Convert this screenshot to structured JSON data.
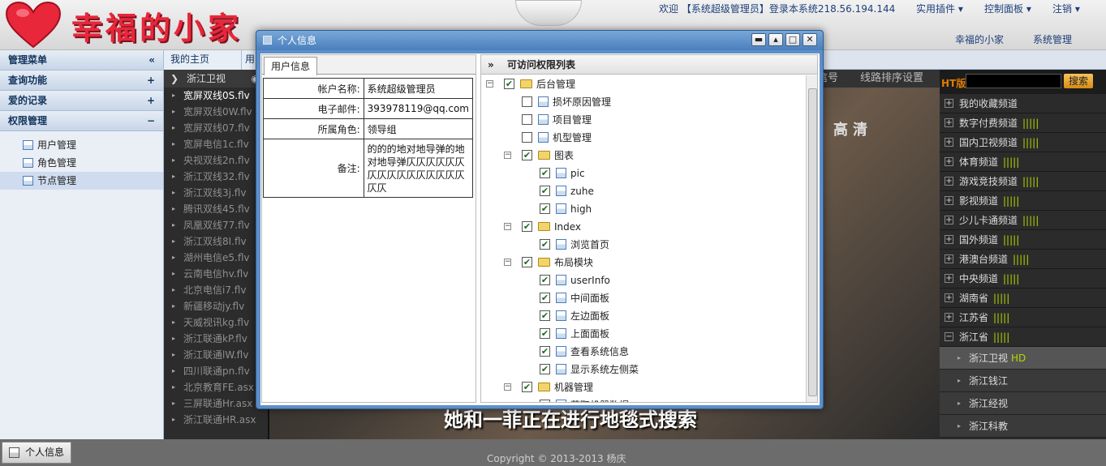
{
  "header": {
    "logo_text": "幸福的小家",
    "welcome": "欢迎 【系统超级管理员】登录本系统218.56.194.144",
    "menu": [
      "实用插件 ▾",
      "控制面板 ▾",
      "注销 ▾"
    ],
    "links": [
      "幸福的小家",
      "系统管理"
    ]
  },
  "sidebar": {
    "title": "管理菜单",
    "title_sym": "«",
    "groups": [
      {
        "label": "查询功能",
        "sym": "+"
      },
      {
        "label": "爱的记录",
        "sym": "+"
      },
      {
        "label": "权限管理",
        "sym": "−"
      }
    ],
    "items": [
      "用户管理",
      "角色管理",
      "节点管理"
    ]
  },
  "tabs": [
    "我的主页",
    "用"
  ],
  "channels": {
    "header": "浙江卫视",
    "arrow": "❯",
    "eye": "◉",
    "items": [
      "宽屏双线0S.flv",
      "宽屏双线0W.flv",
      "宽屏双线07.flv",
      "宽屏电信1c.flv",
      "央视双线2n.flv",
      "浙江双线32.flv",
      "浙江双线3j.flv",
      "腾讯双线45.flv",
      "凤凰双线77.flv",
      "浙江双线8I.flv",
      "湖州电信e5.flv",
      "云南电信hv.flv",
      "北京电信i7.flv",
      "新疆移动jy.flv",
      "天威视讯kg.flv",
      "浙江联通kP.flv",
      "浙江联通lW.flv",
      "四川联通pn.flv",
      "北京教育FE.asx",
      "三屏联通Hr.asx",
      "浙江联通HR.asx"
    ]
  },
  "video": {
    "tabs_right": "线路排序设置",
    "tab_partial": "信号",
    "logo": "高清",
    "subtitle": "她和一菲正在进行地毯式搜索"
  },
  "right_panel": {
    "ht_label": "HT版",
    "search_btn": "搜索",
    "groups": [
      {
        "label": "我的收藏频道",
        "bars": ""
      },
      {
        "label": "数字付费频道",
        "bars": "|||||"
      },
      {
        "label": "国内卫视频道",
        "bars": "|||||"
      },
      {
        "label": "体育频道",
        "bars": "|||||"
      },
      {
        "label": "游戏竞技频道",
        "bars": "|||||"
      },
      {
        "label": "影视频道",
        "bars": "|||||"
      },
      {
        "label": "少儿卡通频道",
        "bars": "|||||"
      },
      {
        "label": "国外频道",
        "bars": "|||||"
      },
      {
        "label": "港澳台频道",
        "bars": "|||||"
      },
      {
        "label": "中央频道",
        "bars": "|||||"
      },
      {
        "label": "湖南省",
        "bars": "|||||"
      },
      {
        "label": "江苏省",
        "bars": "|||||"
      },
      {
        "label": "浙江省",
        "bars": "|||||"
      }
    ],
    "subs": [
      {
        "label": "浙江卫视",
        "hd": "HD"
      },
      {
        "label": "浙江钱江",
        "hd": ""
      },
      {
        "label": "浙江经视",
        "hd": ""
      },
      {
        "label": "浙江科教",
        "hd": ""
      }
    ]
  },
  "dialog": {
    "title": "个人信息",
    "btn_min": "▬",
    "btn_up": "▴",
    "btn_max": "□",
    "btn_close": "✕",
    "left_tab": "用户信息",
    "fields": [
      {
        "key": "帐户名称:",
        "value": "系统超级管理员"
      },
      {
        "key": "电子邮件:",
        "value": "393978119@qq.com"
      },
      {
        "key": "所属角色:",
        "value": "领导组"
      },
      {
        "key": "备注:",
        "value": "的的的地对地导弹的地对地导弹仄仄仄仄仄仄仄仄仄仄仄仄仄仄仄仄仄仄"
      }
    ],
    "right_title": "可访问权限列表",
    "right_sym": "»",
    "tree": [
      {
        "label": "后台管理",
        "level": 0,
        "folder": true,
        "checked": true,
        "exp": "−"
      },
      {
        "label": "损坏原因管理",
        "level": 1,
        "folder": false,
        "checked": false
      },
      {
        "label": "项目管理",
        "level": 1,
        "folder": false,
        "checked": false
      },
      {
        "label": "机型管理",
        "level": 1,
        "folder": false,
        "checked": false
      },
      {
        "label": "图表",
        "level": 1,
        "folder": true,
        "checked": true,
        "exp": "−"
      },
      {
        "label": "pic",
        "level": 2,
        "folder": false,
        "checked": true
      },
      {
        "label": "zuhe",
        "level": 2,
        "folder": false,
        "checked": true
      },
      {
        "label": "high",
        "level": 2,
        "folder": false,
        "checked": true
      },
      {
        "label": "Index",
        "level": 1,
        "folder": true,
        "checked": true,
        "exp": "−"
      },
      {
        "label": "浏览首页",
        "level": 2,
        "folder": false,
        "checked": true
      },
      {
        "label": "布局模块",
        "level": 1,
        "folder": true,
        "checked": true,
        "exp": "−"
      },
      {
        "label": "userInfo",
        "level": 2,
        "folder": false,
        "checked": true
      },
      {
        "label": "中间面板",
        "level": 2,
        "folder": false,
        "checked": true
      },
      {
        "label": "左边面板",
        "level": 2,
        "folder": false,
        "checked": true
      },
      {
        "label": "上面面板",
        "level": 2,
        "folder": false,
        "checked": true
      },
      {
        "label": "查看系统信息",
        "level": 2,
        "folder": false,
        "checked": true
      },
      {
        "label": "显示系统左侧菜",
        "level": 2,
        "folder": false,
        "checked": true
      },
      {
        "label": "机器管理",
        "level": 1,
        "folder": true,
        "checked": true,
        "exp": "−"
      },
      {
        "label": "获取机器数据",
        "level": 2,
        "folder": false,
        "checked": false
      }
    ]
  },
  "footer": {
    "copyright": "Copyright © 2013-2013 杨庆",
    "task_label": "个人信息"
  },
  "colors": {
    "accent": "#4a7fbd",
    "hd": "#b6d600",
    "logo": "#e8273a"
  }
}
